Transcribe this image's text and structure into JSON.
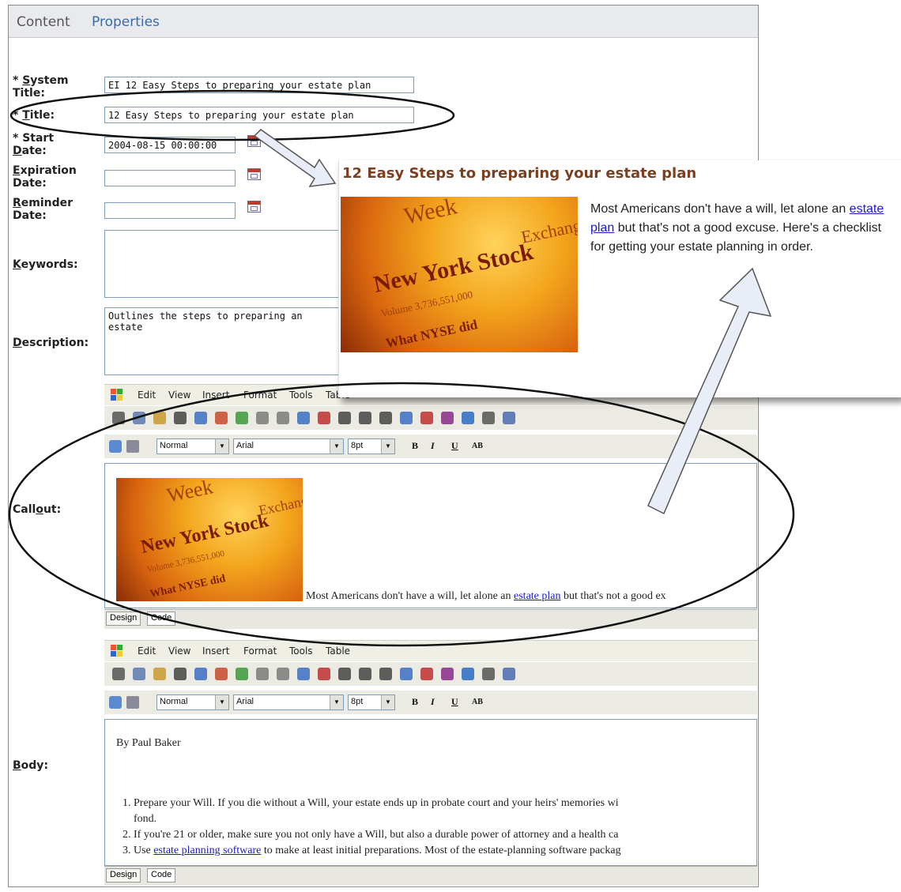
{
  "tabs": {
    "content": "Content",
    "properties": "Properties"
  },
  "fields": {
    "system_title": {
      "label_a": "* ",
      "label_key": "S",
      "label_b": "ystem",
      "label_c": "Title:",
      "value": "EI 12 Easy Steps to preparing your estate plan"
    },
    "title": {
      "label_a": "* ",
      "label_key": "T",
      "label_b": "itle:",
      "value": "12 Easy Steps to preparing your estate plan"
    },
    "start_date": {
      "label_a": "* Start",
      "label_key": "D",
      "label_b": "ate:",
      "value": "2004-08-15 00:00:00"
    },
    "expiration_date": {
      "label_key": "E",
      "label_a": "xpiration",
      "label_b": "Date:",
      "value": ""
    },
    "reminder_date": {
      "label_key": "R",
      "label_a": "eminder",
      "label_b": "Date:",
      "value": ""
    },
    "keywords": {
      "label_key": "K",
      "label_b": "eywords:",
      "value": ""
    },
    "description": {
      "label_key": "D",
      "label_b": "escription:",
      "value": "Outlines the steps to preparing an estate"
    },
    "callout": {
      "label_a": "Call",
      "label_key": "o",
      "label_b": "ut:"
    },
    "body": {
      "label_key": "B",
      "label_b": "ody:"
    }
  },
  "editor_menu": [
    "Edit",
    "View",
    "Insert",
    "Format",
    "Tools",
    "Table"
  ],
  "editor_toolbar": {
    "style": "Normal",
    "font": "Arial",
    "size": "8pt",
    "bold": "B",
    "italic": "I",
    "underline": "U",
    "caps": "AB"
  },
  "mode_tabs": {
    "design": "Design",
    "code": "Code"
  },
  "stock_image": {
    "line1": "Week",
    "line2": "New York Stock",
    "line3": "Exchange",
    "line4": "Volume 3,736,551,000",
    "line5": "What NYSE did"
  },
  "callout_content": {
    "text_a": "Most Americans don't have a will, let alone an ",
    "link": "estate plan",
    "text_b": " but that's not a good ex"
  },
  "body_content": {
    "author": "By Paul Baker",
    "items": [
      {
        "text": "Prepare your Will.  If you die without a Will, your estate ends up in probate court and your heirs' memories wi",
        "cont": "fond."
      },
      {
        "text": "If you're 21 or older, make sure you not only have a Will, but also a durable power of attorney and a health ca"
      },
      {
        "text_a": "Use ",
        "link": "estate planning software",
        "text_b": " to make at least initial preparations. Most of the estate-planning software packag"
      }
    ]
  },
  "preview": {
    "title": "12 Easy Steps to preparing your estate plan",
    "text_a": "Most Americans don't have a will, let alone an ",
    "link": "estate plan",
    "text_b": " but that's not a good excuse. Here's a checklist for getting your estate planning in order."
  },
  "colors": {
    "tab_active": "#555555",
    "tab_link": "#3a6aa8",
    "preview_title": "#7a4022",
    "link": "#1a1acc"
  }
}
